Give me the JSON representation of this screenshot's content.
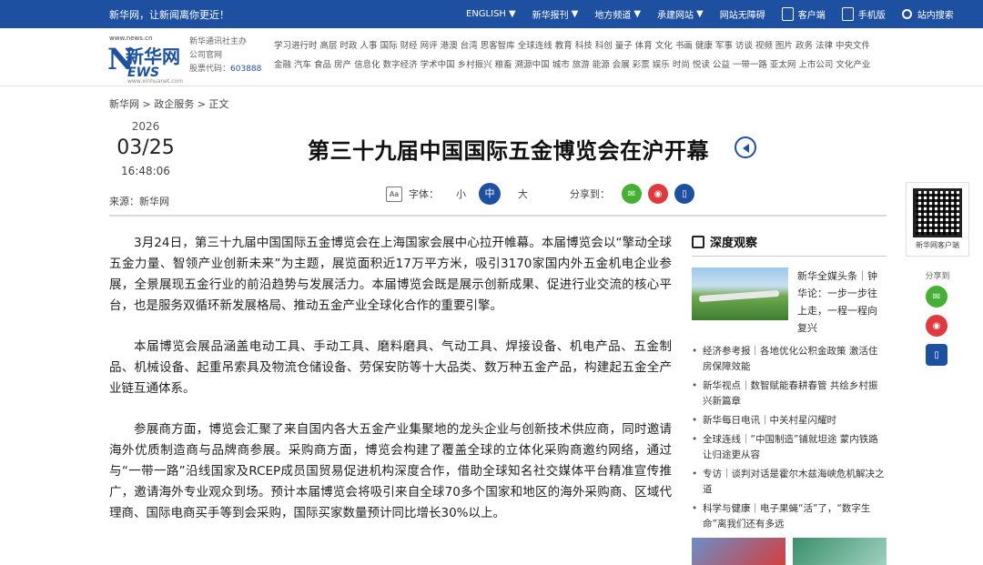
{
  "topbar": {
    "slogan": "新华网，让新闻离你更近！",
    "nav": [
      {
        "label": "ENGLISH",
        "dropdown": true
      },
      {
        "label": "新华报刊",
        "dropdown": true
      },
      {
        "label": "地方频道",
        "dropdown": true
      },
      {
        "label": "承建网站",
        "dropdown": true
      },
      {
        "label": "网站无障碍",
        "dropdown": false
      }
    ],
    "client_label": "客户端",
    "mobile_label": "手机版",
    "search_label": "站内搜索"
  },
  "header": {
    "logo": {
      "url_top": "www.news.cn",
      "brand": "新华网",
      "brand_en": "EWS",
      "url_bottom": "www.xinhuanet.com"
    },
    "company_line1": "新华通讯社主办",
    "company_line2": "公司官网",
    "stock_label": "股票代码：",
    "stock_code": "603888",
    "categories_row1": "学习进行时 高层 时政 人事 国际 财经 网评 港澳 台湾 思客智库 全球连线 教育 科技 科创 量子 体育 文化 书画 健康 军事 访谈 视频 图片 政务 法律 中央文件",
    "categories_row2": "金融 汽车 食品 房产 信息化 数字经济 学术中国 乡村振兴 粮畜 溯源中国 城市 旅游 能源 会展 彩票 娱乐 时尚 悦读 公益 一带一路 亚太网 上市公司 文化产业"
  },
  "breadcrumb": "新华网 > 政企服务 > 正文",
  "date": {
    "year": "2026",
    "month_day": "03/25",
    "time": "16:48:06"
  },
  "source": "来源：新华网",
  "article": {
    "title": "第三十九届中国国际五金博览会在沪开幕",
    "font_label": "字体：",
    "font_small": "小",
    "font_medium": "中",
    "font_large": "大",
    "share_label": "分享到：",
    "paragraphs": [
      "3月24日，第三十九届中国国际五金博览会在上海国家会展中心拉开帷幕。本届博览会以“擎动全球五金力量、智领产业创新未来”为主题，展览面积近17万平方米，吸引3170家国内外五金机电企业参展，全景展现五金行业的前沿趋势与发展活力。本届博览会既是展示创新成果、促进行业交流的核心平台，也是服务双循环新发展格局、推动五金产业全球化合作的重要引擎。",
      "本届博览会展品涵盖电动工具、手动工具、磨料磨具、气动工具、焊接设备、机电产品、五金制品、机械设备、起重吊索具及物流仓储设备、劳保安防等十大品类、数万种五金产品，构建起五金全产业链互通体系。",
      "参展商方面，博览会汇聚了来自国内各大五金产业集聚地的龙头企业与创新技术供应商，同时邀请海外优质制造商与品牌商参展。采购商方面，博览会构建了覆盖全球的立体化采购商邀约网络，通过与“一带一路”沿线国家及RCEP成员国贸易促进机构深度合作，借助全球知名社交媒体平台精准宣传推广，邀请海外专业观众到场。预计本届博览会将吸引来自全球70多个国家和地区的海外采购商、区域代理商、国际电商买手等到会采购，国际买家数量预计同比增长30%以上。"
    ]
  },
  "sidebar": {
    "heading": "深度观察",
    "feature_text": "新华全媒头条｜钟华论：一步一步往上走，一程一程向复兴",
    "items": [
      "经济参考报｜各地优化公积金政策 激活住房保障效能",
      "新华视点｜数智赋能春耕春管 共绘乡村振兴新篇章",
      "新华每日电讯｜中关村星闪耀时",
      "全球连线｜“中国制造”铺就坦途 蒙内铁路让归途更从容",
      "专访｜谈判对话是霍尔木兹海峡危机解决之道",
      "科学与健康｜电子果蝇“活”了，“数字生命”离我们还有多远"
    ]
  },
  "float": {
    "qr_caption": "新华网客户端",
    "share_label": "分享到"
  }
}
